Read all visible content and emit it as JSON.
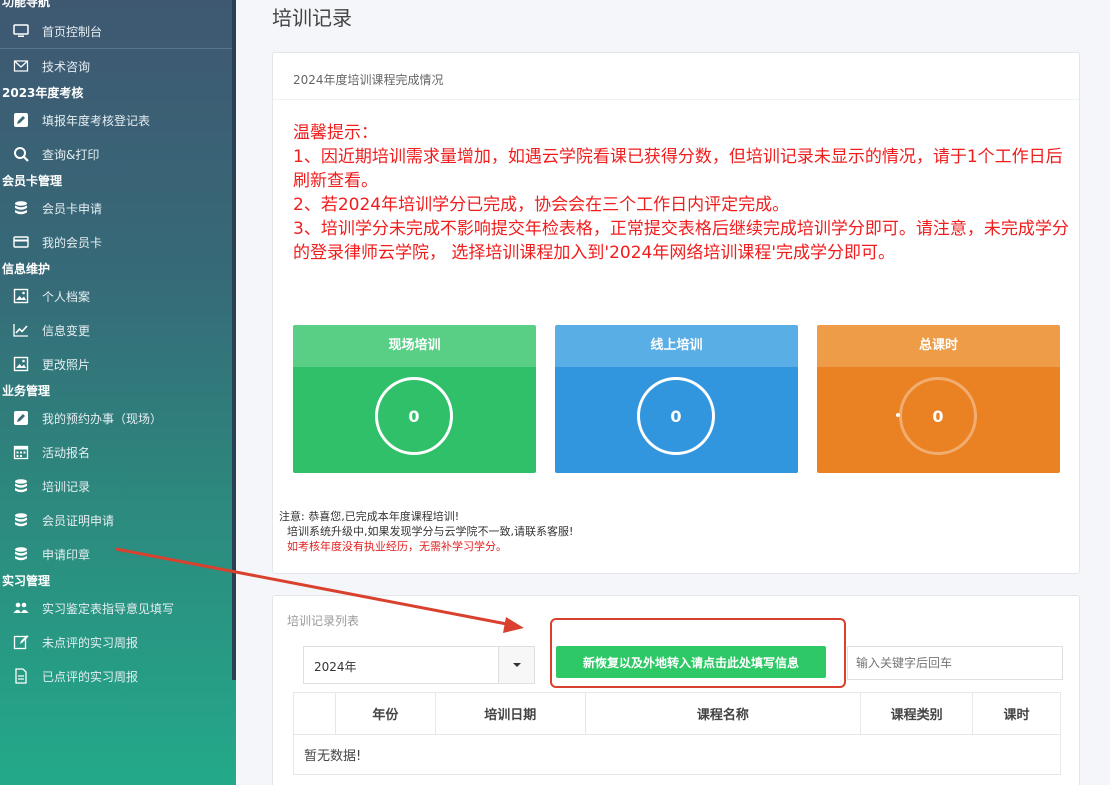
{
  "sidebar": {
    "first_section_partial": "功能导航",
    "items": [
      {
        "label": "首页控制台",
        "icon": "monitor-icon"
      },
      {
        "label": "技术咨询",
        "icon": "mail-icon"
      },
      {
        "section": "2023年度考核"
      },
      {
        "label": "填报年度考核登记表",
        "icon": "edit-icon"
      },
      {
        "label": "查询&打印",
        "icon": "search-icon"
      },
      {
        "section": "会员卡管理"
      },
      {
        "label": "会员卡申请",
        "icon": "database-icon"
      },
      {
        "label": "我的会员卡",
        "icon": "card-icon"
      },
      {
        "section": "信息维护"
      },
      {
        "label": "个人档案",
        "icon": "picture-icon"
      },
      {
        "label": "信息变更",
        "icon": "chart-line-icon"
      },
      {
        "label": "更改照片",
        "icon": "picture-icon"
      },
      {
        "section": "业务管理"
      },
      {
        "label": "我的预约办事（现场）",
        "icon": "edit-icon"
      },
      {
        "label": "活动报名",
        "icon": "calendar-icon"
      },
      {
        "label": "培训记录",
        "icon": "database-icon"
      },
      {
        "label": "会员证明申请",
        "icon": "database-icon"
      },
      {
        "label": "申请印章",
        "icon": "database-icon"
      },
      {
        "section": "实习管理"
      },
      {
        "label": "实习鉴定表指导意见填写",
        "icon": "users-icon"
      },
      {
        "label": "未点评的实习周报",
        "icon": "pencil-icon"
      },
      {
        "label": "已点评的实习周报",
        "icon": "file-icon"
      }
    ]
  },
  "page": {
    "title": "培训记录",
    "panel1_title": "2024年度培训课程完成情况",
    "notice": [
      "温馨提示：",
      "1、因近期培训需求量增加，如遇云学院看课已获得分数，但培训记录未显示的情况，请于1个工作日后刷新查看。",
      "2、若2024年培训学分已完成，协会会在三个工作日内评定完成。",
      "3、培训学分未完成不影响提交年检表格，正常提交表格后继续完成培训学分即可。请注意，未完成学分的登录律师云学院， 选择培训课程加入到'2024年网络培训课程'完成学分即可。"
    ],
    "stats": [
      {
        "label": "现场培训",
        "value": "0"
      },
      {
        "label": "线上培训",
        "value": "0"
      },
      {
        "label": "总课时",
        "value": "0"
      }
    ],
    "note_lines": [
      "注意: 恭喜您,已完成本年度课程培训!",
      "培训系统升级中,如果发现学分与云学院不一致,请联系客服!",
      "如考核年度没有执业经历，无需补学习学分。"
    ],
    "panel2_title": "培训记录列表",
    "year_select": "2024年",
    "green_button": "新恢复以及外地转入请点击此处填写信息",
    "search_placeholder": "输入关键字后回车",
    "table": {
      "headers": [
        "",
        "年份",
        "培训日期",
        "课程名称",
        "课程类别",
        "课时"
      ],
      "empty": "暂无数据!"
    }
  },
  "colors": {
    "green": "#31c06a",
    "blue": "#3196de",
    "orange": "#ea8224",
    "notice_red": "#f01d1d",
    "annotation_red": "#d9412e"
  }
}
